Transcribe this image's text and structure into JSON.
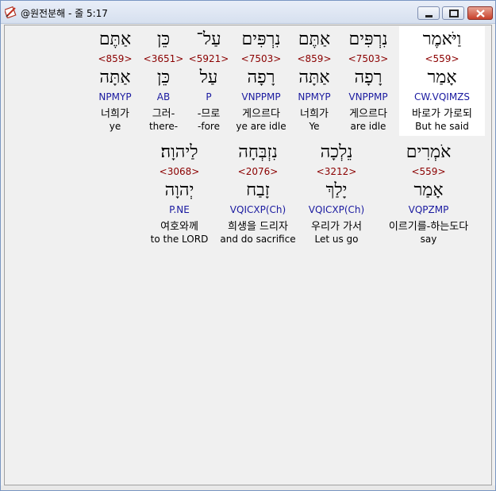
{
  "window": {
    "title": "@원전분해 - 줄 5:17",
    "app_icon": "book-pencil-icon",
    "buttons": [
      "minimize",
      "maximize",
      "close"
    ]
  },
  "rows": [
    {
      "words": [
        {
          "hebrew": "וַיֹּאמֶר",
          "strong": "<559>",
          "lemma": "אָמַר",
          "morph": "CW.VQIMZS",
          "korean": "바로가 가로되",
          "english": "But he said",
          "highlighted": true
        },
        {
          "hebrew": "נִרְפִּים",
          "strong": "<7503>",
          "lemma": "רָפָה",
          "morph": "VNPPMP",
          "korean": "게으르다",
          "english": "are idle"
        },
        {
          "hebrew": "אַתֶּם",
          "strong": "<859>",
          "lemma": "אַתָּה",
          "morph": "NPMYP",
          "korean": "너희가",
          "english": "Ye"
        },
        {
          "hebrew": "נִרְפִּים",
          "strong": "<7503>",
          "lemma": "רָפָה",
          "morph": "VNPPMP",
          "korean": "게으르다",
          "english": "ye are idle"
        },
        {
          "hebrew": "עַל־",
          "strong": "<5921>",
          "lemma": "עַל",
          "morph": "P",
          "korean": "-므로",
          "english": "-fore"
        },
        {
          "hebrew": "כֵּן",
          "strong": "<3651>",
          "lemma": "כֵּן",
          "morph": "AB",
          "korean": "그러-",
          "english": "there-"
        },
        {
          "hebrew": "אַתֶּם",
          "strong": "<859>",
          "lemma": "אַתָּה",
          "morph": "NPMYP",
          "korean": "너희가",
          "english": "ye"
        }
      ]
    },
    {
      "words": [
        {
          "hebrew": "אֹמְרִים",
          "strong": "<559>",
          "lemma": "אָמַר",
          "morph": "VQPZMP",
          "korean": "이르기를-하는도다",
          "english": "say"
        },
        {
          "hebrew": "נֵלְכָה",
          "strong": "<3212>",
          "lemma": "יָלַךְ",
          "morph": "VQICXP(Ch)",
          "korean": "우리가 가서",
          "english": "Let us go"
        },
        {
          "hebrew": "נִזְבְּחָה",
          "strong": "<2076>",
          "lemma": "זָבַח",
          "morph": "VQICXP(Ch)",
          "korean": "희생을 드리자",
          "english": "and do sacrifice"
        },
        {
          "hebrew": "לַיהוָה׃",
          "strong": "<3068>",
          "lemma": "יְהוָה",
          "morph": "P.NE",
          "korean": "여호와께",
          "english": "to the LORD"
        }
      ]
    }
  ]
}
